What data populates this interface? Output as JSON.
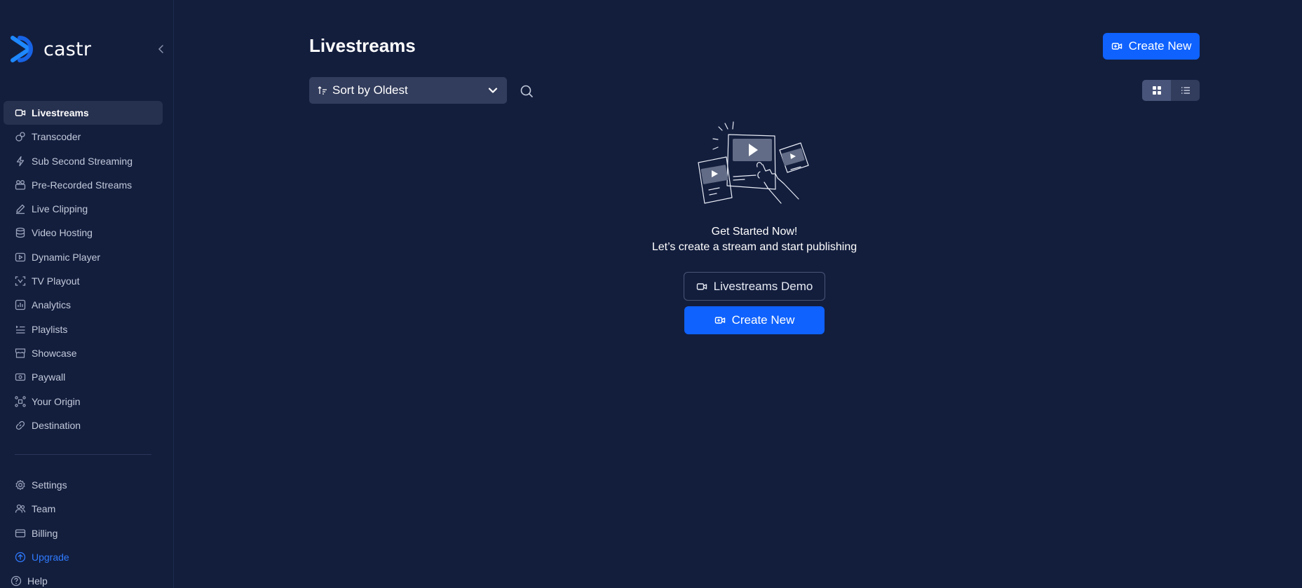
{
  "brand": {
    "name": "castr"
  },
  "sidebar": {
    "items": [
      {
        "label": "Livestreams",
        "icon": "video-camera-icon",
        "active": true
      },
      {
        "label": "Transcoder",
        "icon": "transcoder-icon"
      },
      {
        "label": "Sub Second Streaming",
        "icon": "lightning-icon"
      },
      {
        "label": "Pre-Recorded Streams",
        "icon": "pre-recorded-icon"
      },
      {
        "label": "Live Clipping",
        "icon": "pen-icon"
      },
      {
        "label": "Video Hosting",
        "icon": "database-icon"
      },
      {
        "label": "Dynamic Player",
        "icon": "play-box-icon"
      },
      {
        "label": "TV Playout",
        "icon": "tv-playout-icon"
      },
      {
        "label": "Analytics",
        "icon": "analytics-icon"
      },
      {
        "label": "Playlists",
        "icon": "playlist-icon"
      },
      {
        "label": "Showcase",
        "icon": "store-icon"
      },
      {
        "label": "Paywall",
        "icon": "money-icon"
      },
      {
        "label": "Your Origin",
        "icon": "origin-icon"
      },
      {
        "label": "Destination",
        "icon": "link-icon"
      }
    ],
    "bottom_items": [
      {
        "label": "Settings",
        "icon": "gear-icon"
      },
      {
        "label": "Team",
        "icon": "team-icon"
      },
      {
        "label": "Billing",
        "icon": "card-icon"
      },
      {
        "label": "Upgrade",
        "icon": "upgrade-icon"
      },
      {
        "label": "Help",
        "icon": "help-icon"
      }
    ]
  },
  "header": {
    "title": "Livestreams",
    "create_label": "Create New"
  },
  "toolbar": {
    "sort_label": "Sort by Oldest"
  },
  "empty_state": {
    "title": "Get Started Now!",
    "subtitle": "Let’s create a stream and start publishing",
    "demo_label": "Livestreams Demo",
    "create_label": "Create New"
  },
  "colors": {
    "background": "#131e3d",
    "accent": "#0f62fe",
    "upgrade": "#2f7bff",
    "active_item": "#26304f"
  }
}
